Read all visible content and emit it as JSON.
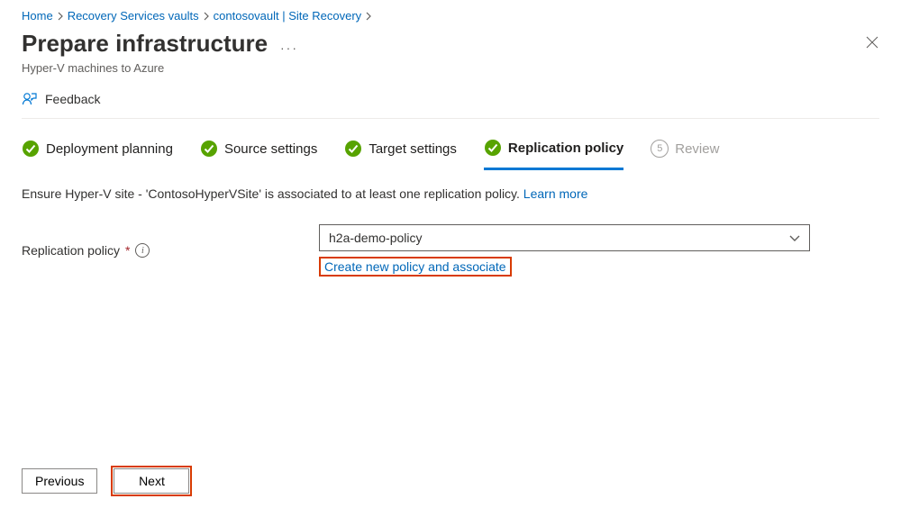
{
  "breadcrumbs": [
    {
      "label": "Home"
    },
    {
      "label": "Recovery Services vaults"
    },
    {
      "label": "contosovault | Site Recovery"
    }
  ],
  "header": {
    "title": "Prepare infrastructure",
    "subtitle": "Hyper-V machines to Azure"
  },
  "toolbar": {
    "feedback": "Feedback"
  },
  "steps": {
    "deployment_planning": "Deployment planning",
    "source_settings": "Source settings",
    "target_settings": "Target settings",
    "replication_policy": "Replication policy",
    "review_num": "5",
    "review": "Review"
  },
  "hint": {
    "text": "Ensure Hyper-V site - 'ContosoHyperVSite' is associated to at least one replication policy. ",
    "learn_more": "Learn more"
  },
  "field": {
    "label": "Replication policy",
    "required": "*",
    "value": "h2a-demo-policy",
    "create_link": "Create new policy and associate"
  },
  "footer": {
    "previous": "Previous",
    "next": "Next"
  }
}
